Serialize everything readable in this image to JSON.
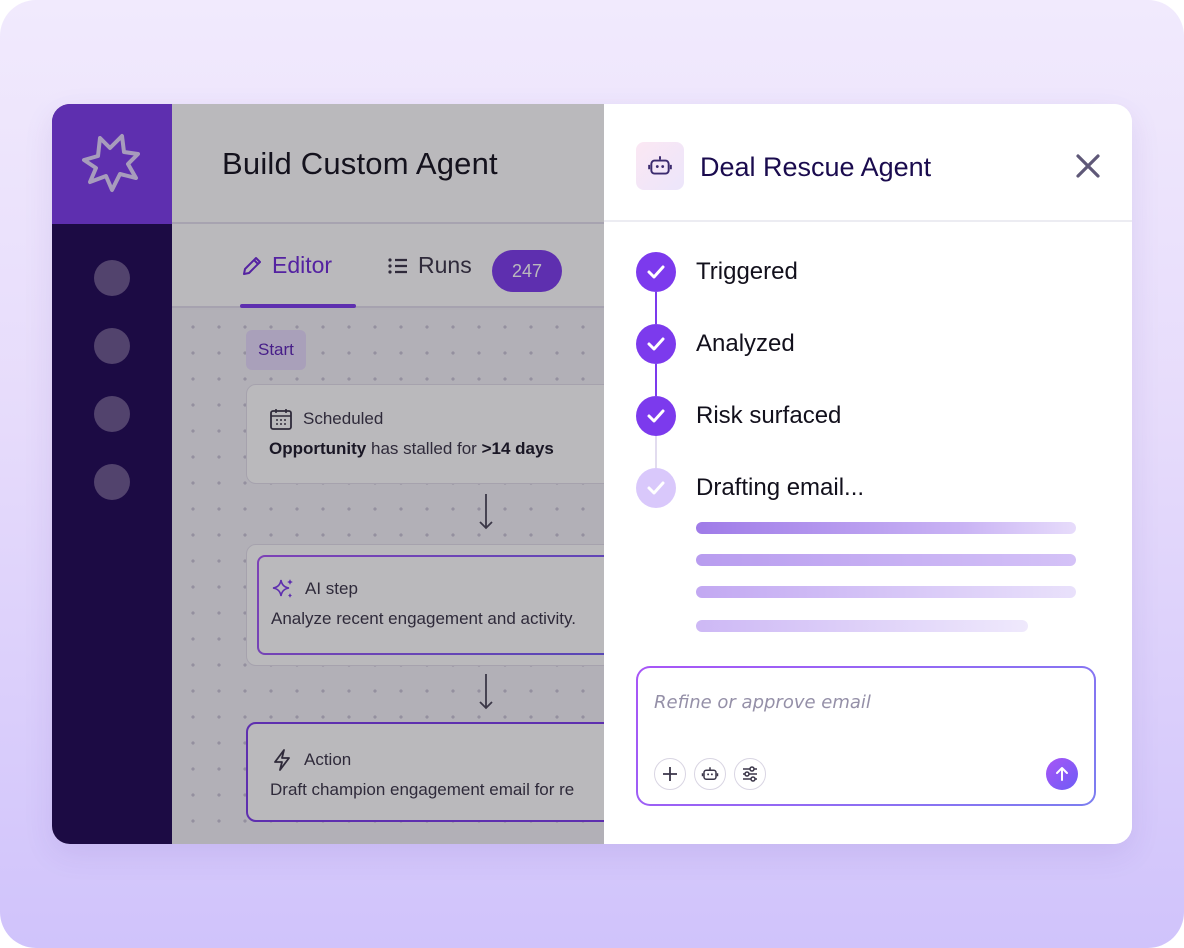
{
  "app": {
    "title": "Build Custom Agent",
    "brand_color": "#7c3aed",
    "rail_color": "#1e0653",
    "logo_icon": "starburst-logo-icon",
    "rail_items": [
      "nav-item-1",
      "nav-item-2",
      "nav-item-3",
      "nav-item-4"
    ]
  },
  "tabs": {
    "editor": {
      "label": "Editor",
      "icon": "pencil-icon"
    },
    "runs": {
      "label": "Runs",
      "icon": "list-icon",
      "count": "247"
    }
  },
  "canvas": {
    "start_label": "Start",
    "trigger": {
      "title": "Scheduled",
      "icon": "calendar-icon",
      "subject": "Opportunity",
      "condition": "has stalled for",
      "threshold": ">14 days"
    },
    "ai_step": {
      "title": "AI step",
      "icon": "sparkles-icon",
      "body": "Analyze recent engagement and activity."
    },
    "action": {
      "title": "Action",
      "icon": "lightning-icon",
      "body": "Draft champion engagement email for re"
    }
  },
  "drawer": {
    "title": "Deal Rescue Agent",
    "icon": "robot-icon",
    "close_icon": "close-icon",
    "steps": [
      {
        "label": "Triggered",
        "status": "done"
      },
      {
        "label": "Analyzed",
        "status": "done"
      },
      {
        "label": "Risk surfaced",
        "status": "done"
      },
      {
        "label": "Drafting email...",
        "status": "in-progress"
      }
    ],
    "composer": {
      "placeholder": "Refine or approve email",
      "tools": [
        "plus-icon",
        "robot-icon",
        "sliders-icon"
      ],
      "send_icon": "arrow-up-icon"
    }
  }
}
